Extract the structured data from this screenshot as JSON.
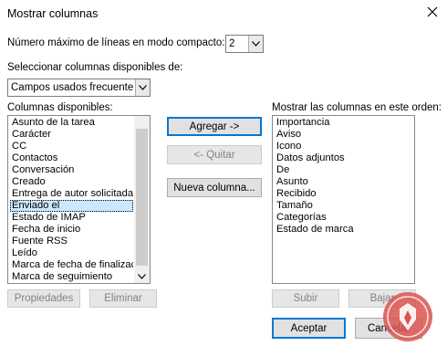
{
  "window": {
    "title": "Mostrar columnas"
  },
  "compact": {
    "label": "Número máximo de líneas en modo compacto:",
    "value": "2"
  },
  "available_select": {
    "label": "Seleccionar columnas disponibles de:",
    "value": "Campos usados frecuente"
  },
  "available_list": {
    "label": "Columnas disponibles:",
    "items": [
      "Asunto de la tarea",
      "Carácter",
      "CC",
      "Contactos",
      "Conversación",
      "Creado",
      "Entrega de autor solicitada",
      "Enviado el",
      "Estado de IMAP",
      "Fecha de inicio",
      "Fuente RSS",
      "Leído",
      "Marca de fecha de finalizac",
      "Marca de seguimiento"
    ],
    "selected": "Enviado el"
  },
  "shown_list": {
    "label": "Mostrar las columnas en este orden:",
    "items": [
      "Importancia",
      "Aviso",
      "Icono",
      "Datos adjuntos",
      "De",
      "Asunto",
      "Recibido",
      "Tamaño",
      "Categorías",
      "Estado de marca"
    ]
  },
  "buttons": {
    "add": "Agregar ->",
    "remove": "<- Quitar",
    "new_column": "Nueva columna...",
    "properties": "Propiedades",
    "delete": "Eliminar",
    "move_up": "Subir",
    "move_down": "Bajar",
    "accept": "Aceptar",
    "cancel": "Cancelar"
  },
  "icons": {
    "close": "close-icon",
    "dropdown": "chevron-down-icon",
    "scroll_down": "scroll-down-arrow-icon",
    "watermark": "site-logo"
  },
  "colors": {
    "selection": "#cce8ff",
    "primary_border": "#0078d7",
    "button_face": "#e1e1e1",
    "logo": "#d9534f"
  }
}
